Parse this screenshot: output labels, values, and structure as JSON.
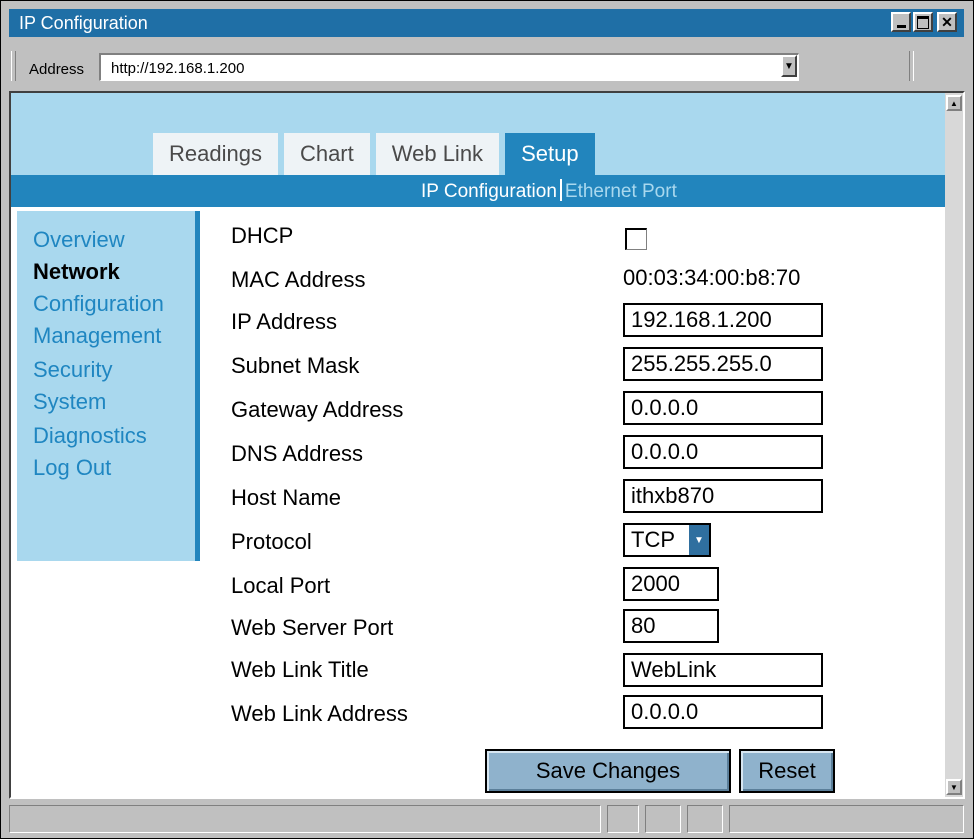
{
  "window": {
    "title": "IP Configuration"
  },
  "address_bar": {
    "label": "Address",
    "url": "http://192.168.1.200"
  },
  "tabs": [
    {
      "label": "Readings",
      "active": false
    },
    {
      "label": "Chart",
      "active": false
    },
    {
      "label": "Web Link",
      "active": false
    },
    {
      "label": "Setup",
      "active": true
    }
  ],
  "subnav": {
    "active": "IP Configuration",
    "other": "Ethernet Port"
  },
  "sidebar": {
    "items": [
      {
        "label": "Overview",
        "bold": false
      },
      {
        "label": "Network",
        "bold": true
      },
      {
        "label": "Configuration",
        "bold": false
      },
      {
        "label": "Management",
        "bold": false
      },
      {
        "label": "Security",
        "bold": false
      },
      {
        "label": "System",
        "bold": false
      },
      {
        "label": "Diagnostics",
        "bold": false
      },
      {
        "label": "Log Out",
        "bold": false
      }
    ]
  },
  "form": {
    "dhcp": {
      "label": "DHCP",
      "checked": false
    },
    "mac": {
      "label": "MAC Address",
      "value": "00:03:34:00:b8:70"
    },
    "ip": {
      "label": "IP Address",
      "value": "192.168.1.200"
    },
    "subnet": {
      "label": "Subnet Mask",
      "value": "255.255.255.0"
    },
    "gateway": {
      "label": "Gateway Address",
      "value": "0.0.0.0"
    },
    "dns": {
      "label": "DNS Address",
      "value": "0.0.0.0"
    },
    "host": {
      "label": "Host Name",
      "value": "ithxb870"
    },
    "protocol": {
      "label": "Protocol",
      "value": "TCP"
    },
    "local_port": {
      "label": "Local Port",
      "value": "2000"
    },
    "web_port": {
      "label": "Web Server Port",
      "value": "80"
    },
    "weblink_title": {
      "label": "Web Link Title",
      "value": "WebLink"
    },
    "weblink_address": {
      "label": "Web Link Address",
      "value": "0.0.0.0"
    }
  },
  "buttons": {
    "save": "Save Changes",
    "reset": "Reset"
  },
  "colors": {
    "accent": "#2285bd",
    "banner": "#a9d8ee",
    "link": "#1f86c1",
    "titlebar": "#1f6fa6"
  }
}
